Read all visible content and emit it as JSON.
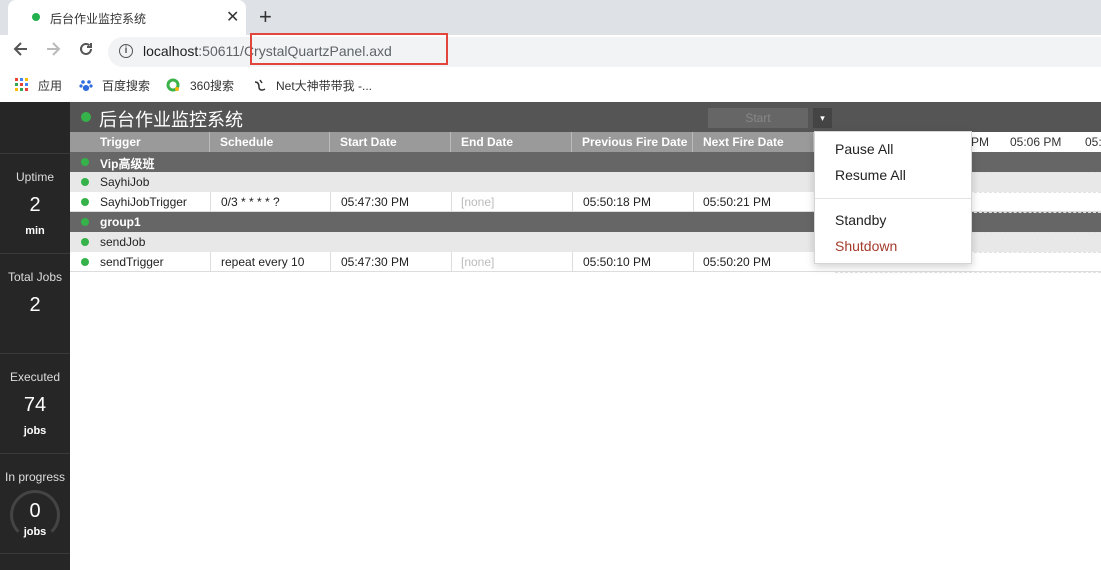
{
  "browser": {
    "tab_title": "后台作业监控系统",
    "close_glyph": "✕",
    "new_tab_glyph": "+",
    "url_host": "localhost",
    "url_port": ":50611/",
    "url_path": "CrystalQuartzPanel.axd",
    "bookmarks": [
      {
        "label": "应用",
        "icon": "apps-grid-icon"
      },
      {
        "label": "百度搜索",
        "icon": "baidu-paw-icon"
      },
      {
        "label": "360搜索",
        "icon": "search-360-icon"
      },
      {
        "label": "Net大神带带我 -...",
        "icon": "bookmark-logo-icon"
      }
    ],
    "highlight_color": "#e2453c"
  },
  "sidebar": {
    "uptime": {
      "label": "Uptime",
      "value": "2",
      "unit": "min"
    },
    "total_jobs": {
      "label": "Total Jobs",
      "value": "2"
    },
    "executed": {
      "label": "Executed",
      "value": "74",
      "unit": "jobs"
    },
    "in_progress": {
      "label": "In progress",
      "value": "0",
      "unit": "jobs"
    }
  },
  "header": {
    "title": "后台作业监控系统",
    "start_label": "Start",
    "caret": "▾"
  },
  "columns": [
    "Trigger",
    "Schedule",
    "Start Date",
    "End Date",
    "Previous Fire Date",
    "Next Fire Date"
  ],
  "timeline_ticks": [
    "PM",
    "05:06 PM",
    "05:"
  ],
  "groups": [
    {
      "name": "Vip高级班",
      "jobs": [
        {
          "name": "SayhiJob",
          "triggers": [
            {
              "name": "SayhiJobTrigger",
              "schedule": "0/3 * * * * ?",
              "start": "05:47:30 PM",
              "end": "[none]",
              "prev": "05:50:18 PM",
              "next": "05:50:21 PM"
            }
          ]
        }
      ]
    },
    {
      "name": "group1",
      "jobs": [
        {
          "name": "sendJob",
          "triggers": [
            {
              "name": "sendTrigger",
              "schedule": "repeat every 10",
              "start": "05:47:30 PM",
              "end": "[none]",
              "prev": "05:50:10 PM",
              "next": "05:50:20 PM"
            }
          ]
        }
      ]
    }
  ],
  "menu": {
    "pause_all": "Pause All",
    "resume_all": "Resume All",
    "standby": "Standby",
    "shutdown": "Shutdown"
  },
  "colors": {
    "status_ok": "#35b34a",
    "danger": "#a33b2b"
  }
}
